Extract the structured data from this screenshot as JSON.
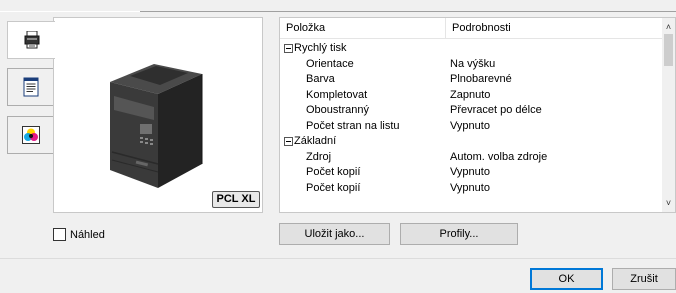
{
  "tabs": [
    {
      "icon": "printer-icon",
      "active": true
    },
    {
      "icon": "document-icon",
      "active": false
    },
    {
      "icon": "color-icon",
      "active": false
    }
  ],
  "preview": {
    "badge": "PCL XL"
  },
  "preview_checkbox": {
    "label": "Náhled",
    "checked": false
  },
  "list": {
    "headers": [
      "Položka",
      "Podrobnosti"
    ],
    "rows": [
      {
        "type": "group",
        "name": "Rychlý tisk",
        "value": ""
      },
      {
        "type": "item",
        "name": "Orientace",
        "value": "Na výšku"
      },
      {
        "type": "item",
        "name": "Barva",
        "value": "Plnobarevné"
      },
      {
        "type": "item",
        "name": "Kompletovat",
        "value": "Zapnuto"
      },
      {
        "type": "item",
        "name": "Oboustranný",
        "value": "Převracet po délce"
      },
      {
        "type": "item",
        "name": "Počet stran na listu",
        "value": "Vypnuto"
      },
      {
        "type": "group",
        "name": "Základní",
        "value": ""
      },
      {
        "type": "item",
        "name": "Zdroj",
        "value": "Autom. volba zdroje"
      },
      {
        "type": "item",
        "name": "Počet kopií",
        "value": "Vypnuto"
      },
      {
        "type": "item",
        "name": "Počet kopií",
        "value": "Vypnuto"
      }
    ]
  },
  "buttons": {
    "save_as": "Uložit jako...",
    "profiles": "Profily...",
    "ok": "OK",
    "cancel": "Zrušit"
  },
  "colors": {
    "accent": "#0078d7"
  }
}
